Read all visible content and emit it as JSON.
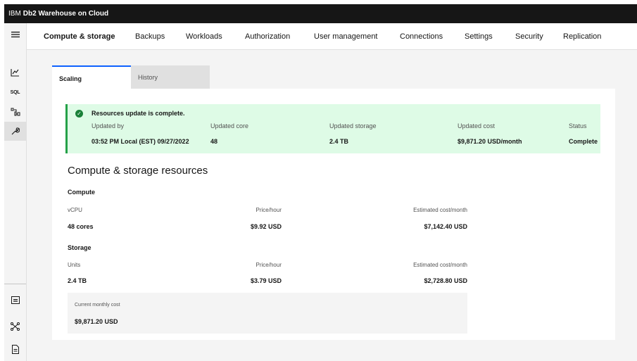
{
  "header": {
    "brand_prefix": "IBM",
    "brand_name": "Db2 Warehouse on Cloud"
  },
  "rail": {
    "icons": [
      "menu-icon",
      "chart-icon",
      "sql-icon",
      "data-icon",
      "wrench-icon",
      "console-icon",
      "network-icon",
      "document-icon"
    ],
    "sql_label": "SQL"
  },
  "nav": {
    "tabs": [
      {
        "label": "Compute & storage",
        "active": true
      },
      {
        "label": "Backups"
      },
      {
        "label": "Workloads"
      },
      {
        "label": "Authorization"
      },
      {
        "label": "User management"
      },
      {
        "label": "Connections"
      },
      {
        "label": "Settings"
      },
      {
        "label": "Security"
      },
      {
        "label": "Replication"
      }
    ]
  },
  "subtabs": {
    "scaling": "Scaling",
    "history": "History"
  },
  "notice": {
    "title": "Resources update is complete.",
    "headers": {
      "updated_by": "Updated by",
      "updated_core": "Updated core",
      "updated_storage": "Updated storage",
      "updated_cost": "Updated cost",
      "status": "Status"
    },
    "values": {
      "updated_by": "03:52 PM Local (EST) 09/27/2022",
      "updated_core": "48",
      "updated_storage": "2.4 TB",
      "updated_cost": "$9,871.20 USD/month",
      "status": "Complete"
    }
  },
  "resources": {
    "title": "Compute & storage resources",
    "compute": {
      "title": "Compute",
      "col1_label": "vCPU",
      "col2_label": "Price/hour",
      "col3_label": "Estimated cost/month",
      "col1_value": "48 cores",
      "col2_value": "$9.92 USD",
      "col3_value": "$7,142.40 USD"
    },
    "storage": {
      "title": "Storage",
      "col1_label": "Units",
      "col2_label": "Price/hour",
      "col3_label": "Estimated cost/month",
      "col1_value": "2.4 TB",
      "col2_value": "$3.79 USD",
      "col3_value": "$2,728.80 USD"
    },
    "monthly": {
      "label": "Current monthly cost",
      "value": "$9,871.20 USD"
    }
  },
  "colors": {
    "accent": "#0f62fe",
    "success": "#24a148",
    "success_bg": "#defbe6",
    "topbar": "#161616"
  }
}
